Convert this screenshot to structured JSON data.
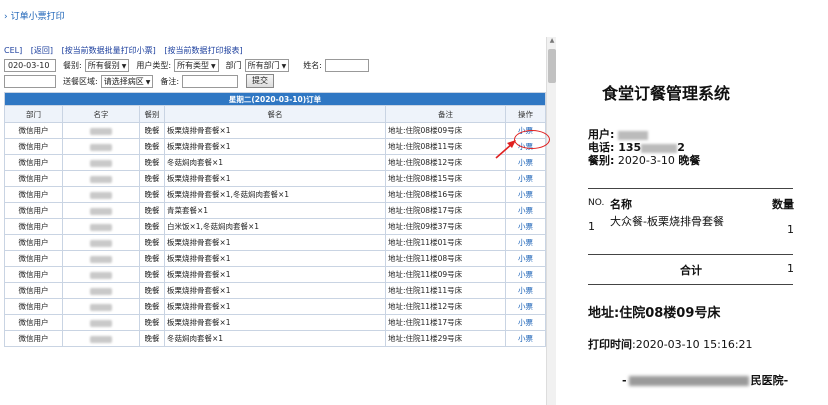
{
  "breadcrumb": {
    "chevron": "›",
    "text": "订单小票打印"
  },
  "toolbar": {
    "links": [
      "CEL]",
      "[返回]",
      "[按当前数据批量打印小票]",
      "[按当前数据打印报表]"
    ]
  },
  "filters": {
    "date_value": "020-03-10",
    "meal_label": "餐别:",
    "meal_value": "所有餐别",
    "usertype_label": "用户类型:",
    "usertype_value": "所有类型",
    "dept_label": "部门",
    "dept_value": "所有部门",
    "name_label": "姓名:",
    "name_value": "",
    "area_label": "送餐区域:",
    "area_value": "请选择病区",
    "remark_label": "备注:",
    "remark_value": "",
    "submit_label": "提交"
  },
  "table": {
    "title": "星期二(2020-03-10)订单",
    "headers": [
      "部门",
      "名字",
      "餐别",
      "餐名",
      "备注",
      "操作"
    ],
    "rows": [
      {
        "dept": "微信用户",
        "meal": "晚餐",
        "dish": "板栗烧排骨套餐×1",
        "remark": "地址:住院08楼09号床",
        "action": "小票"
      },
      {
        "dept": "微信用户",
        "meal": "晚餐",
        "dish": "板栗烧排骨套餐×1",
        "remark": "地址:住院08楼11号床",
        "action": "小票"
      },
      {
        "dept": "微信用户",
        "meal": "晚餐",
        "dish": "冬菇焖肉套餐×1",
        "remark": "地址:住院08楼12号床",
        "action": "小票"
      },
      {
        "dept": "微信用户",
        "meal": "晚餐",
        "dish": "板栗烧排骨套餐×1",
        "remark": "地址:住院08楼15号床",
        "action": "小票"
      },
      {
        "dept": "微信用户",
        "meal": "晚餐",
        "dish": "板栗烧排骨套餐×1,冬菇焖肉套餐×1",
        "remark": "地址:住院08楼16号床",
        "action": "小票"
      },
      {
        "dept": "微信用户",
        "meal": "晚餐",
        "dish": "青菜套餐×1",
        "remark": "地址:住院08楼17号床",
        "action": "小票"
      },
      {
        "dept": "微信用户",
        "meal": "晚餐",
        "dish": "白米饭×1,冬菇焖肉套餐×1",
        "remark": "地址:住院09楼37号床",
        "action": "小票"
      },
      {
        "dept": "微信用户",
        "meal": "晚餐",
        "dish": "板栗烧排骨套餐×1",
        "remark": "地址:住院11楼01号床",
        "action": "小票"
      },
      {
        "dept": "微信用户",
        "meal": "晚餐",
        "dish": "板栗烧排骨套餐×1",
        "remark": "地址:住院11楼08号床",
        "action": "小票"
      },
      {
        "dept": "微信用户",
        "meal": "晚餐",
        "dish": "板栗烧排骨套餐×1",
        "remark": "地址:住院11楼09号床",
        "action": "小票"
      },
      {
        "dept": "微信用户",
        "meal": "晚餐",
        "dish": "板栗烧排骨套餐×1",
        "remark": "地址:住院11楼11号床",
        "action": "小票"
      },
      {
        "dept": "微信用户",
        "meal": "晚餐",
        "dish": "板栗烧排骨套餐×1",
        "remark": "地址:住院11楼12号床",
        "action": "小票"
      },
      {
        "dept": "微信用户",
        "meal": "晚餐",
        "dish": "板栗烧排骨套餐×1",
        "remark": "地址:住院11楼17号床",
        "action": "小票"
      },
      {
        "dept": "微信用户",
        "meal": "晚餐",
        "dish": "冬菇焖肉套餐×1",
        "remark": "地址:住院11楼29号床",
        "action": "小票"
      }
    ]
  },
  "receipt": {
    "title": "食堂订餐管理系统",
    "user_label": "用户:",
    "phone_label": "电话:",
    "phone_prefix": "135",
    "phone_suffix": "2",
    "meal_label": "餐别:",
    "meal_date": "2020-3-10",
    "meal_type": "晚餐",
    "col_no": "NO.",
    "col_name": "名称",
    "col_qty": "数量",
    "item_no": "1",
    "item_name": "大众餐-板栗烧排骨套餐",
    "item_qty": "1",
    "total_label": "合计",
    "total_value": "1",
    "address": "地址:住院08楼09号床",
    "print_label": "打印时间",
    "print_time": ":2020-03-10 15:16:21",
    "footer_prefix": "-",
    "footer_suffix": "民医院-"
  }
}
